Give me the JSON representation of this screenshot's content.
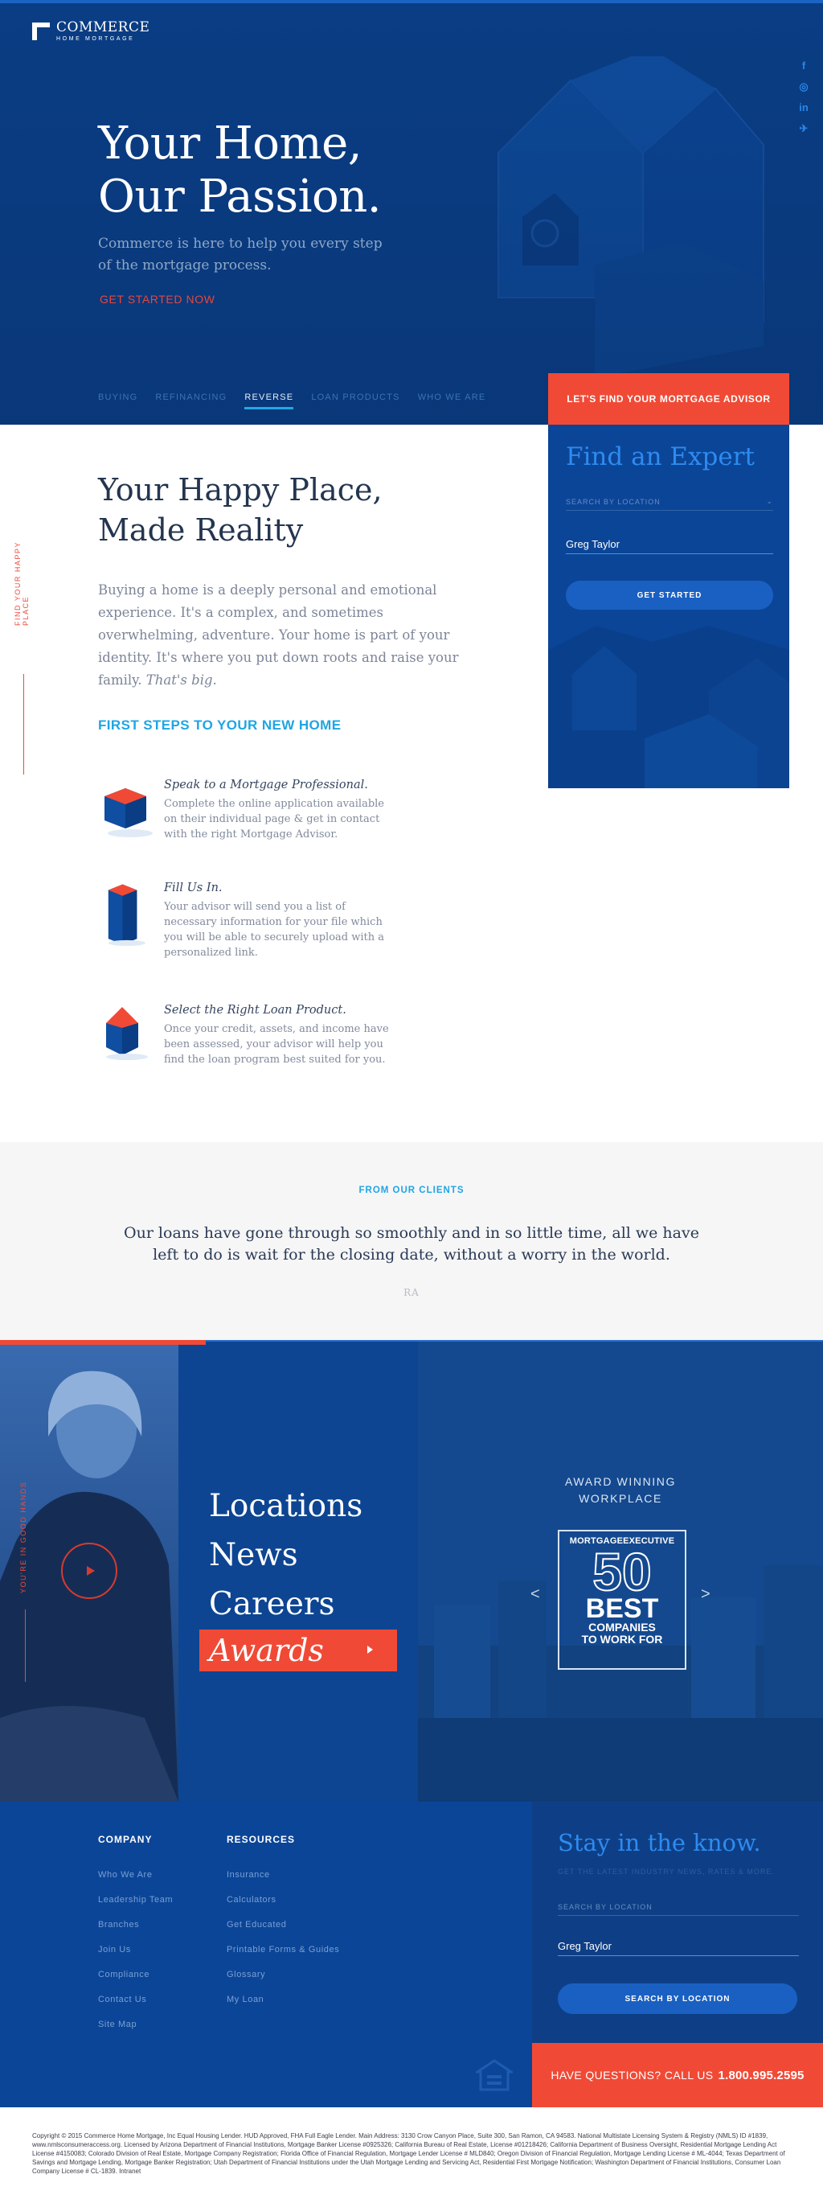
{
  "brand": {
    "name": "COMMERCE",
    "tagline": "HOME MORTGAGE",
    "colors": {
      "navy": "#0a3d84",
      "accent_red": "#f04a36",
      "accent_blue": "#1fa5e3",
      "link_blue": "#2e8bf0"
    }
  },
  "social": [
    {
      "icon": "facebook-icon",
      "glyph": "f"
    },
    {
      "icon": "instagram-icon",
      "glyph": "◎"
    },
    {
      "icon": "linkedin-icon",
      "glyph": "in"
    },
    {
      "icon": "twitter-icon",
      "glyph": "✈"
    }
  ],
  "hero": {
    "title_line1": "Your Home,",
    "title_line2": "Our Passion.",
    "subtitle": "Commerce is here to help you every step of the mortgage process.",
    "cta": "GET STARTED NOW"
  },
  "nav": {
    "items": [
      "BUYING",
      "REFINANCING",
      "REVERSE",
      "LOAN PRODUCTS",
      "WHO WE ARE"
    ],
    "active": "REVERSE"
  },
  "expert": {
    "button": "LET'S FIND YOUR MORTGAGE ADVISOR",
    "title": "Find an Expert",
    "location_placeholder": "SEARCH BY LOCATION",
    "name_value": "Greg Taylor",
    "submit": "GET STARTED"
  },
  "about": {
    "side_label": "FIND YOUR HAPPY PLACE",
    "title_line1": "Your Happy Place,",
    "title_line2": "Made Reality",
    "body": "Buying a home is a deeply personal and emotional experience. It's a complex, and sometimes overwhelming, adventure. Your home is part of your identity. It's where you put down roots and raise your family.",
    "body_emphasis": "That's big.",
    "steps_heading": "FIRST STEPS TO YOUR NEW HOME",
    "steps": [
      {
        "title": "Speak to a Mortgage Professional.",
        "desc": "Complete the online application available on their individual page & get in contact with the right Mortgage Advisor."
      },
      {
        "title": "Fill Us In.",
        "desc": "Your advisor will send you a list of necessary information for your file which you will be able to securely upload with a personalized link."
      },
      {
        "title": "Select the Right Loan Product.",
        "desc": "Once your credit, assets, and income have been assessed, your advisor will help you find the loan program best suited for you."
      }
    ]
  },
  "testimonial": {
    "label": "FROM OUR CLIENTS",
    "quote": "Our loans have gone through so smoothly and in so little time, all we have left to do is wait for the closing date, without a worry in the world.",
    "initials": "RA"
  },
  "links": {
    "side_label": "YOU'RE IN GOOD HANDS",
    "items": [
      "Locations",
      "News",
      "Careers"
    ],
    "highlight": "Awards",
    "award_heading_line1": "AWARD WINNING",
    "award_heading_line2": "WORKPLACE",
    "badge": {
      "brand": "MORTGAGEEXECUTIVE",
      "number": "50",
      "best": "BEST",
      "line1": "COMPANIES",
      "line2": "TO WORK FOR"
    },
    "prev": "<",
    "next": ">"
  },
  "footer": {
    "company_heading": "COMPANY",
    "company_links": [
      "Who We Are",
      "Leadership Team",
      "Branches",
      "Join Us",
      "Compliance",
      "Contact Us",
      "Site Map"
    ],
    "resources_heading": "RESOURCES",
    "resource_links": [
      "Insurance",
      "Calculators",
      "Get Educated",
      "Printable Forms & Guides",
      "Glossary",
      "My Loan"
    ],
    "newsletter": {
      "title": "Stay in the know.",
      "subtitle": "GET THE LATEST INDUSTRY NEWS, RATES & MORE.",
      "location_placeholder": "SEARCH BY LOCATION",
      "name_value": "Greg Taylor",
      "button": "SEARCH BY LOCATION"
    },
    "questions_label": "HAVE QUESTIONS? CALL US",
    "phone": "1.800.995.2595"
  },
  "legal": "Copyright © 2015 Commerce Home Mortgage, Inc Equal Housing Lender. HUD Approved, FHA Full Eagle Lender. Main Address: 3130 Crow Canyon Place, Suite 300, San Ramon, CA 94583. National Multistate Licensing System & Registry (NMLS) ID #1839, www.nmlsconsumeraccess.org. Licensed by Arizona Department of Financial Institutions, Mortgage Banker License #0925326; California Bureau of Real Estate, License #01218426; California Department of Business Oversight, Residential Mortgage Lending Act License #4150083; Colorado Division of Real Estate, Mortgage Company Registration; Florida Office of Financial Regulation, Mortgage Lender License # MLD840; Oregon Division of Financial Regulation, Mortgage Lending License # ML-4044; Texas Department of Savings and Mortgage Lending, Mortgage Banker Registration; Utah Department of Financial Institutions under the Utah Mortgage Lending and Servicing Act, Residential First Mortgage Notification; Washington Department of Financial Institutions, Consumer Loan Company License # CL-1839. Intranet"
}
